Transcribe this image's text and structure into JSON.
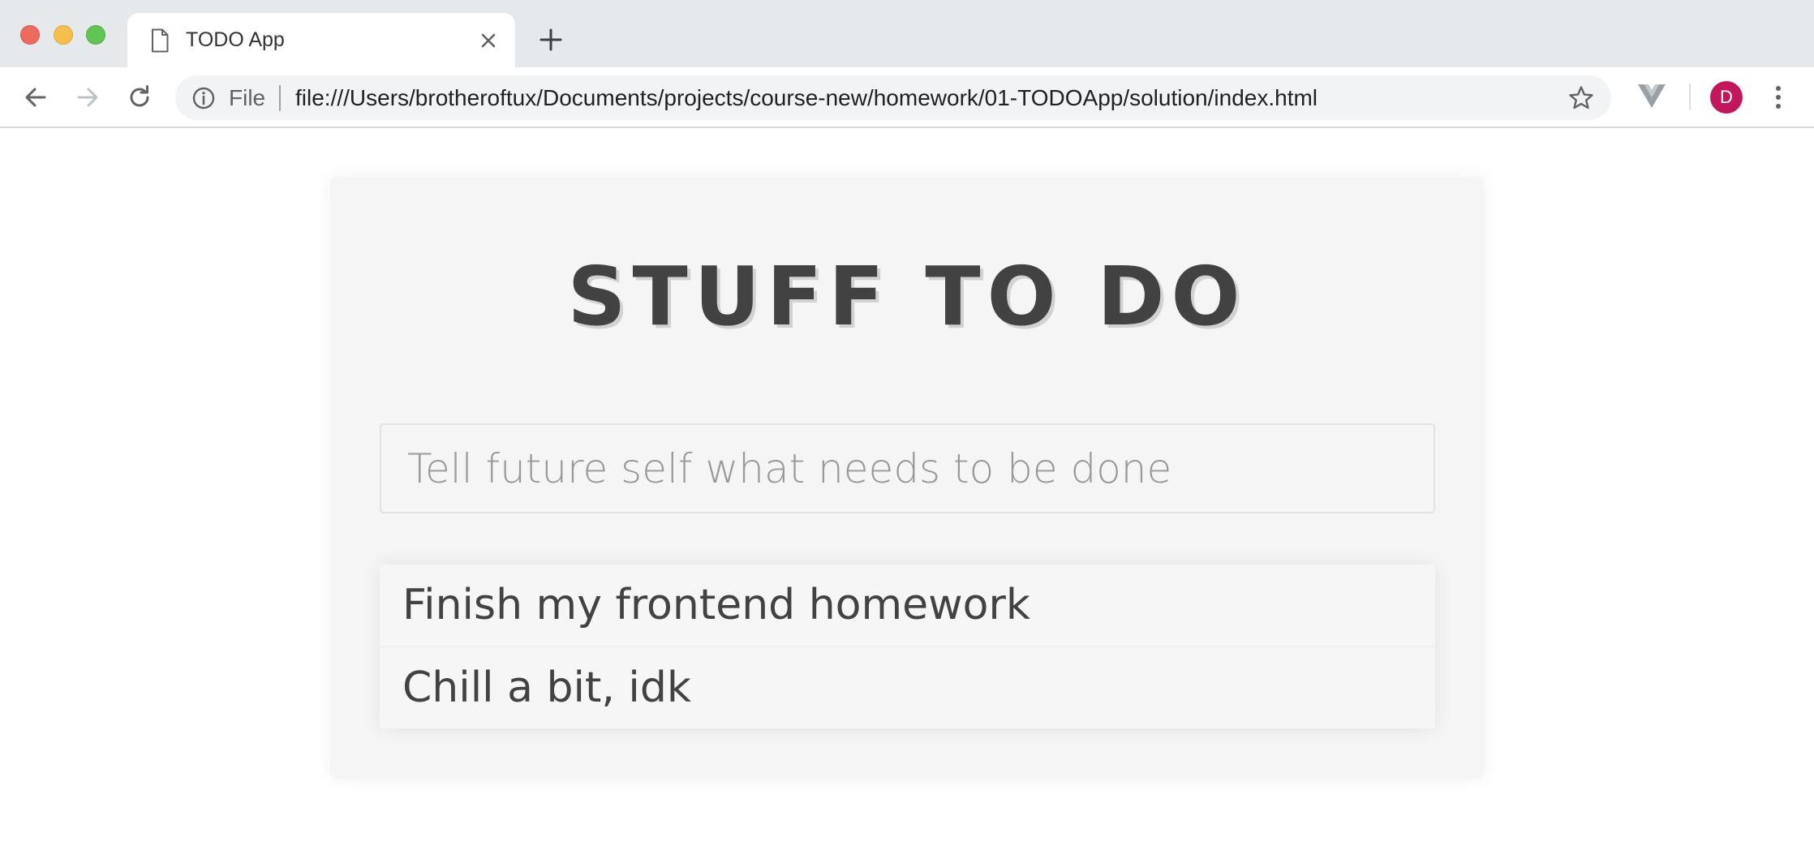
{
  "browser": {
    "tab": {
      "title": "TODO App"
    },
    "address_bar": {
      "scheme_label": "File",
      "url": "file:///Users/brotheroftux/Documents/projects/course-new/homework/01-TODOApp/solution/index.html"
    },
    "profile": {
      "initial": "D",
      "color": "#c2185b"
    },
    "icons": {
      "back": "arrow-left-icon",
      "forward": "arrow-right-icon",
      "reload": "reload-icon",
      "info": "info-icon",
      "bookmark": "star-icon",
      "extension": "vue-devtools-icon",
      "menu": "kebab-menu-icon",
      "close_tab": "close-icon",
      "new_tab": "plus-icon",
      "tab_page": "document-icon"
    }
  },
  "app": {
    "title": "STUFF TO DO",
    "input": {
      "placeholder": "Tell future self what needs to be done",
      "value": ""
    },
    "todos": [
      {
        "text": "Finish my frontend homework"
      },
      {
        "text": "Chill a bit, idk"
      }
    ]
  }
}
